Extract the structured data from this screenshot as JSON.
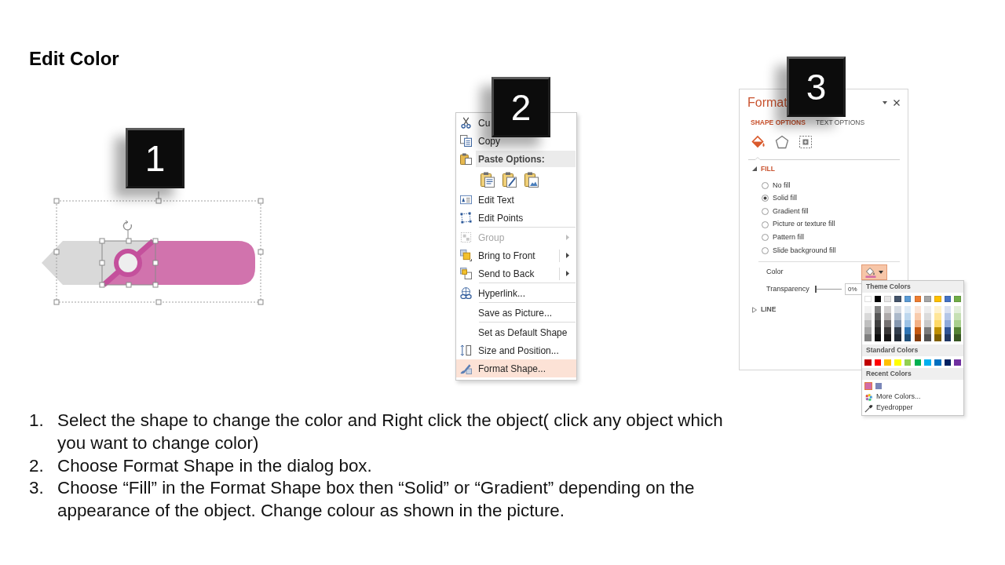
{
  "title": "Edit Color",
  "shape_example": {
    "badge": "1"
  },
  "context_menu": {
    "badge": "2",
    "items": [
      {
        "kind": "item",
        "label": "Cu",
        "selected": false,
        "disabled": false,
        "submenu": false
      },
      {
        "kind": "item",
        "label": "Copy",
        "selected": false,
        "disabled": false,
        "submenu": false
      },
      {
        "kind": "header",
        "label": "Paste Options:"
      },
      {
        "kind": "paste_options"
      },
      {
        "kind": "item",
        "label": "Edit Text",
        "selected": false,
        "disabled": false,
        "submenu": false
      },
      {
        "kind": "item",
        "label": "Edit Points",
        "selected": false,
        "disabled": false,
        "submenu": false
      },
      {
        "kind": "separator"
      },
      {
        "kind": "item",
        "label": "Group",
        "selected": false,
        "disabled": true,
        "submenu": true,
        "split": false
      },
      {
        "kind": "item",
        "label": "Bring to Front",
        "selected": false,
        "disabled": false,
        "submenu": true,
        "split": true
      },
      {
        "kind": "item",
        "label": "Send to Back",
        "selected": false,
        "disabled": false,
        "submenu": true,
        "split": true
      },
      {
        "kind": "separator"
      },
      {
        "kind": "item",
        "label": "Hyperlink...",
        "selected": false,
        "disabled": false,
        "submenu": false
      },
      {
        "kind": "separator"
      },
      {
        "kind": "item",
        "label": "Save as Picture...",
        "selected": false,
        "disabled": false,
        "submenu": false
      },
      {
        "kind": "separator"
      },
      {
        "kind": "item",
        "label": "Set as Default Shape",
        "selected": false,
        "disabled": false,
        "submenu": false
      },
      {
        "kind": "item",
        "label": "Size and Position...",
        "selected": false,
        "disabled": false,
        "submenu": false
      },
      {
        "kind": "item",
        "label": "Format Shape...",
        "selected": true,
        "disabled": false,
        "submenu": false
      }
    ]
  },
  "format_pane": {
    "badge": "3",
    "title": "Format",
    "tabs": [
      {
        "label": "SHAPE OPTIONS",
        "selected": true
      },
      {
        "label": "TEXT OPTIONS",
        "selected": false
      }
    ],
    "category_icons": [
      {
        "selected": true
      },
      {
        "selected": false
      },
      {
        "selected": false
      }
    ],
    "fill": {
      "label": "FILL",
      "expanded": true,
      "options": [
        {
          "label": "No fill",
          "checked": false
        },
        {
          "label": "Solid fill",
          "checked": true
        },
        {
          "label": "Gradient fill",
          "checked": false
        },
        {
          "label": "Picture or texture fill",
          "checked": false
        },
        {
          "label": "Pattern fill",
          "checked": false
        },
        {
          "label": "Slide background fill",
          "checked": false
        }
      ],
      "color_label": "Color",
      "transparency": {
        "label": "Transparency",
        "level": 0,
        "value": "0%"
      }
    },
    "line": {
      "label": "LINE",
      "expanded": false
    },
    "color_menu": {
      "theme_header": "Theme Colors",
      "theme_colors": [
        [
          {
            "color": "#ffffff"
          },
          {
            "color": "#000000"
          },
          {
            "color": "#e7e6e6"
          },
          {
            "color": "#44546a"
          },
          {
            "color": "#5b9bd5"
          },
          {
            "color": "#ed7d31"
          },
          {
            "color": "#a5a5a5"
          },
          {
            "color": "#ffc000"
          },
          {
            "color": "#4472c4"
          },
          {
            "color": "#70ad47"
          }
        ],
        [
          {
            "color": "#f2f2f2"
          },
          {
            "color": "#808080"
          },
          {
            "color": "#d0cece"
          },
          {
            "color": "#d6dce4"
          },
          {
            "color": "#ddebf7"
          },
          {
            "color": "#fce4d6"
          },
          {
            "color": "#ededed"
          },
          {
            "color": "#fff2cc"
          },
          {
            "color": "#d9e1f2"
          },
          {
            "color": "#e2efda"
          }
        ],
        [
          {
            "color": "#d9d9d9"
          },
          {
            "color": "#595959"
          },
          {
            "color": "#aeaaaa"
          },
          {
            "color": "#acb9ca"
          },
          {
            "color": "#bdd7ee"
          },
          {
            "color": "#f8cbad"
          },
          {
            "color": "#dbdbdb"
          },
          {
            "color": "#ffe699"
          },
          {
            "color": "#b4c6e7"
          },
          {
            "color": "#c6e0b4"
          }
        ],
        [
          {
            "color": "#bfbfbf"
          },
          {
            "color": "#404040"
          },
          {
            "color": "#757171"
          },
          {
            "color": "#8497b0"
          },
          {
            "color": "#9bc2e6"
          },
          {
            "color": "#f4b084"
          },
          {
            "color": "#c9c9c9"
          },
          {
            "color": "#ffd966"
          },
          {
            "color": "#8ea9db"
          },
          {
            "color": "#a9d08e"
          }
        ],
        [
          {
            "color": "#a6a6a6"
          },
          {
            "color": "#262626"
          },
          {
            "color": "#3a3838"
          },
          {
            "color": "#333f4f"
          },
          {
            "color": "#2f75b5"
          },
          {
            "color": "#c65911"
          },
          {
            "color": "#7b7b7b"
          },
          {
            "color": "#bf8f00"
          },
          {
            "color": "#305496"
          },
          {
            "color": "#548235"
          }
        ],
        [
          {
            "color": "#808080"
          },
          {
            "color": "#0d0d0d"
          },
          {
            "color": "#171616"
          },
          {
            "color": "#222a35"
          },
          {
            "color": "#1f4e78"
          },
          {
            "color": "#833c0c"
          },
          {
            "color": "#525252"
          },
          {
            "color": "#806000"
          },
          {
            "color": "#203764"
          },
          {
            "color": "#375623"
          }
        ]
      ],
      "standard_header": "Standard Colors",
      "standard_colors": [
        {
          "color": "#c00000"
        },
        {
          "color": "#ff0000"
        },
        {
          "color": "#ffc000"
        },
        {
          "color": "#ffff00"
        },
        {
          "color": "#92d050"
        },
        {
          "color": "#00b050"
        },
        {
          "color": "#00b0f0"
        },
        {
          "color": "#0070c0"
        },
        {
          "color": "#002060"
        },
        {
          "color": "#7030a0"
        }
      ],
      "recent_header": "Recent Colors",
      "recent_colors": [
        {
          "color": "#d36ba6",
          "selected": true
        },
        {
          "color": "#7a86b8",
          "selected": false
        }
      ],
      "more_colors": "More Colors...",
      "eyedropper": "Eyedropper"
    }
  },
  "instructions": [
    {
      "number": "1.",
      "text": "Select the shape to change the color and Right click the object( click any object which you want to change color)"
    },
    {
      "number": "2.",
      "text": "Choose Format Shape in the dialog box."
    },
    {
      "number": "3.",
      "text": "Choose “Fill” in the Format Shape box then “Solid” or “Gradient” depending on the appearance of the object. Change colour as shown in the picture."
    }
  ]
}
